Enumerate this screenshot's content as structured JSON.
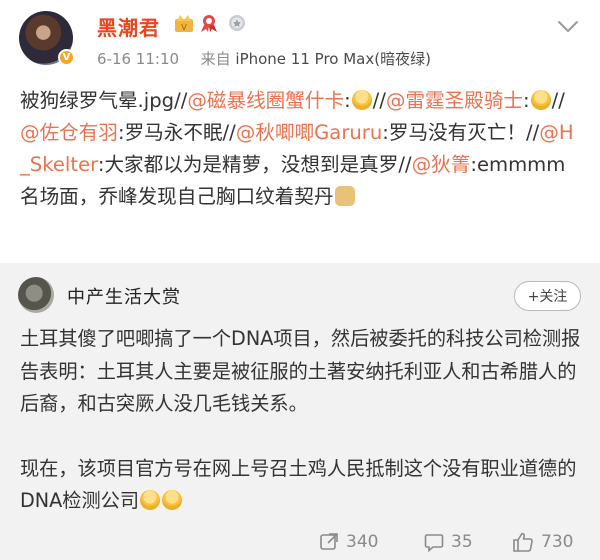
{
  "post": {
    "author": "黑潮君",
    "time": "6-16 11:10",
    "source_prefix": "来自",
    "device": "iPhone 11 Pro Max(暗夜绿)",
    "content": [
      {
        "t": "text",
        "v": "被狗绿罗气晕.jpg//"
      },
      {
        "t": "link",
        "v": "@磁暴线圈蟹什卡"
      },
      {
        "t": "text",
        "v": ":"
      },
      {
        "t": "emoji",
        "name": "laugh-cry-emoji"
      },
      {
        "t": "text",
        "v": "//"
      },
      {
        "t": "link",
        "v": "@雷霆圣殿骑士"
      },
      {
        "t": "text",
        "v": ":"
      },
      {
        "t": "emoji",
        "name": "laugh-cry-emoji"
      },
      {
        "t": "text",
        "v": "//"
      },
      {
        "t": "link",
        "v": "@佐仓有羽"
      },
      {
        "t": "text",
        "v": ":罗马永不眠//"
      },
      {
        "t": "link",
        "v": "@秋唧唧Garuru"
      },
      {
        "t": "text",
        "v": ":罗马没有灭亡！//"
      },
      {
        "t": "link",
        "v": "@H_Skelter"
      },
      {
        "t": "text",
        "v": ":大家都以为是精萝，没想到是真罗//"
      },
      {
        "t": "link",
        "v": "@狄箐"
      },
      {
        "t": "text",
        "v": ":emmmm名场面，乔峰发现自己胸口纹着契丹"
      },
      {
        "t": "emoji",
        "name": "doge-emoji"
      }
    ]
  },
  "repost": {
    "author": "中产生活大赏",
    "follow_label": "+关注",
    "paragraph1": "土耳其傻了吧唧搞了一个DNA项目，然后被委托的科技公司检测报告表明：土耳其人主要是被征服的土著安纳托利亚人和古希腊人的后裔，和古突厥人没几毛钱关系。",
    "paragraph2": "现在，该项目官方号在网上号召土鸡人民抵制这个没有职业道德的DNA检测公司"
  },
  "actions": {
    "repost_count": "340",
    "comment_count": "35",
    "like_count": "730"
  },
  "colors": {
    "username": "#e8481e",
    "link": "#eb7350",
    "repost_bg": "#f2f2f2",
    "meta": "#8a8a8a"
  },
  "icons": [
    "crown-badge-icon",
    "ribbon-badge-icon",
    "medal-badge-icon",
    "chevron-down-icon",
    "repost-icon",
    "comment-icon",
    "like-icon"
  ]
}
